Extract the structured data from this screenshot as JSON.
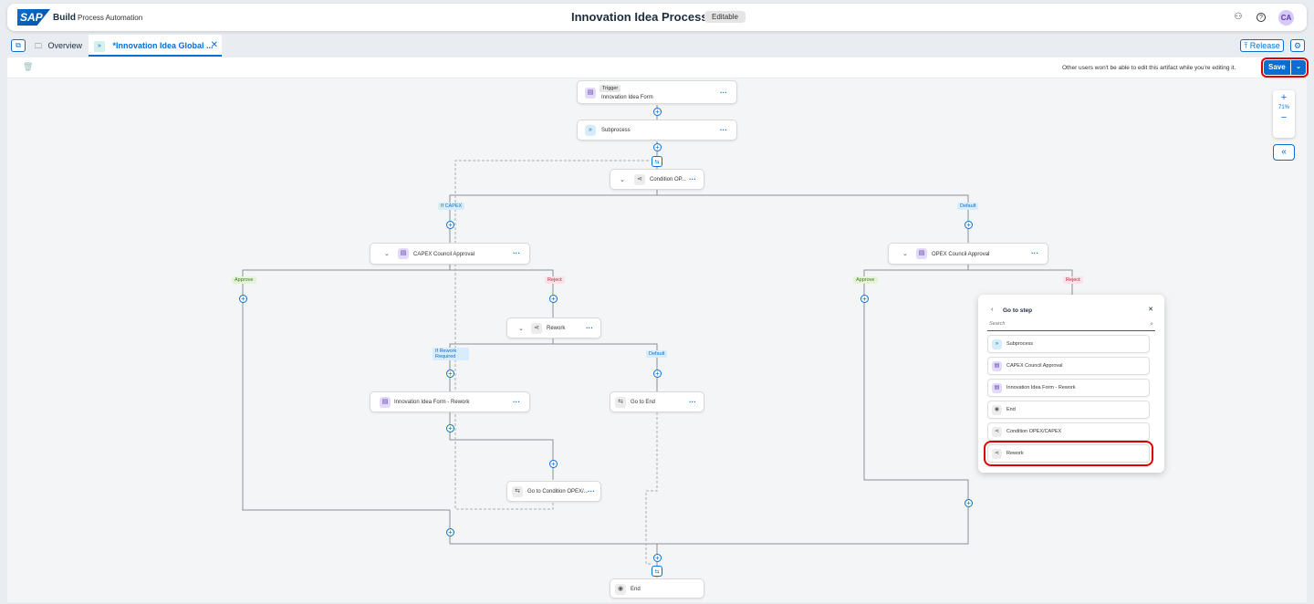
{
  "shell": {
    "logo": "SAP",
    "product": "Build",
    "product_sub": "Process Automation",
    "title": "Innovation Idea Process",
    "badge": "Editable",
    "avatar": "CA",
    "icons": [
      "notifications-icon",
      "help-icon"
    ]
  },
  "tabs": {
    "overview": "Overview",
    "active": "*Innovation Idea Global ...",
    "release": "Release"
  },
  "toolbar": {
    "message": "Other users won't be able to edit this artifact while you're editing it.",
    "save": "Save"
  },
  "zoom": {
    "level": "71%"
  },
  "nodes": {
    "trigger_tag": "Trigger",
    "trigger": "Innovation Idea Form",
    "subprocess": "Subprocess",
    "condition": "Condition OP...",
    "capex": "CAPEX Council Approval",
    "opex": "OPEX Council Approval",
    "rework": "Rework",
    "form_rework": "Innovation Idea Form - Rework",
    "goto_end": "Go to End",
    "goto_cond": "Go to Condition OPEX/...",
    "end": "End"
  },
  "tags": {
    "if_capex": "If CAPEX",
    "default1": "Default",
    "approve1": "Approve",
    "reject1": "Reject",
    "approve2": "Approve",
    "reject2": "Reject",
    "if_rework1": "If Rework",
    "if_rework2": "Required",
    "default2": "Default"
  },
  "popup": {
    "title": "Go to step",
    "search_placeholder": "Search",
    "items": [
      "Subprocess",
      "CAPEX Council Approval",
      "Innovation Idea Form - Rework",
      "End",
      "Condition OPEX/CAPEX",
      "Rework"
    ]
  }
}
